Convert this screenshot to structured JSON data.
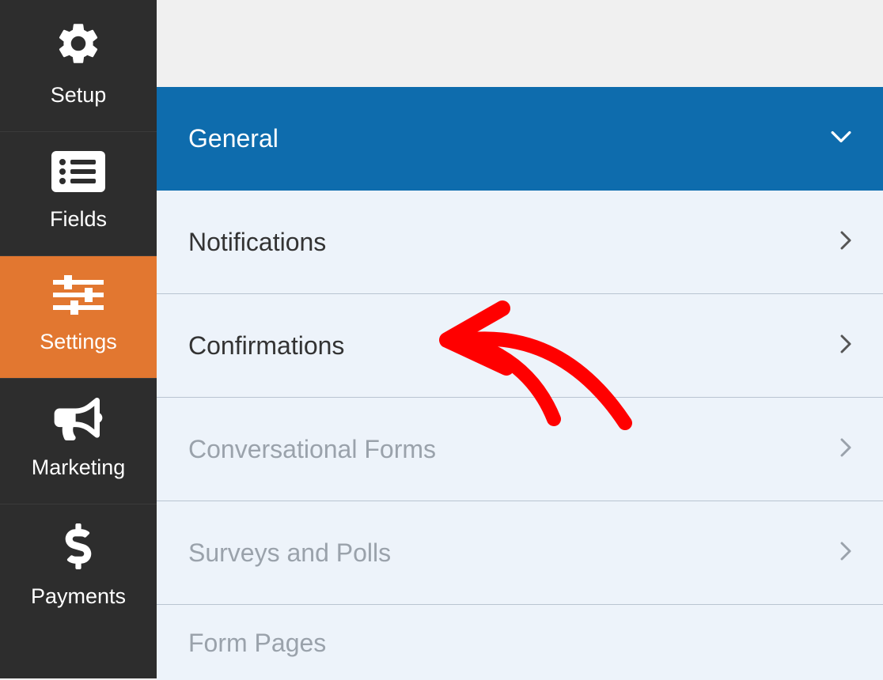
{
  "sidebar": {
    "items": [
      {
        "label": "Setup",
        "icon": "gear-icon",
        "active": false
      },
      {
        "label": "Fields",
        "icon": "list-icon",
        "active": false
      },
      {
        "label": "Settings",
        "icon": "sliders-icon",
        "active": true
      },
      {
        "label": "Marketing",
        "icon": "megaphone-icon",
        "active": false
      },
      {
        "label": "Payments",
        "icon": "dollar-icon",
        "active": false
      }
    ]
  },
  "settings": {
    "rows": [
      {
        "label": "General",
        "active": true,
        "disabled": false
      },
      {
        "label": "Notifications",
        "active": false,
        "disabled": false
      },
      {
        "label": "Confirmations",
        "active": false,
        "disabled": false
      },
      {
        "label": "Conversational Forms",
        "active": false,
        "disabled": true
      },
      {
        "label": "Surveys and Polls",
        "active": false,
        "disabled": true
      },
      {
        "label": "Form Pages",
        "active": false,
        "disabled": true
      }
    ]
  }
}
